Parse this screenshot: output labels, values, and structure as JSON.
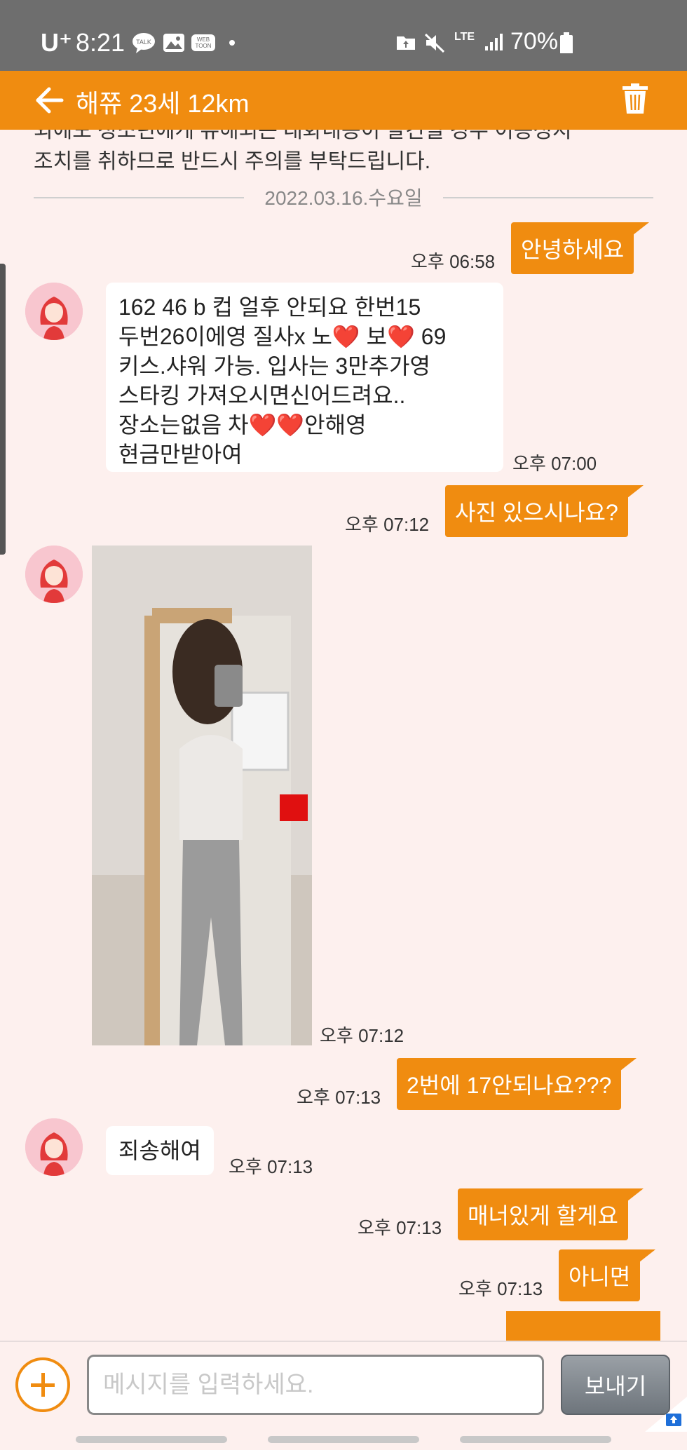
{
  "status_bar": {
    "carrier": "U⁺",
    "time": "8:21",
    "network": "LTE",
    "battery": "70%",
    "icons": [
      "kakaotalk-icon",
      "gallery-icon",
      "webtoon-icon",
      "dot-icon",
      "folder-icon",
      "mute-icon",
      "signal-icon",
      "battery-icon"
    ],
    "colors": {
      "bg": "#6e6e6e"
    }
  },
  "header": {
    "title": "해쮸 23세 12km",
    "back_icon": "arrow-left-icon",
    "delete_icon": "trash-icon",
    "colors": {
      "bg": "#f08c10"
    }
  },
  "chat": {
    "notice_partial": "외에도 청소년에게 유해되는 대화내용이 발견될 경우 이용정지",
    "notice_line2": "조치를 취하므로 반드시 주의를 부탁드립니다.",
    "date": "2022.03.16.수요일",
    "messages": [
      {
        "dir": "out",
        "text": "안녕하세요",
        "time": "오후 06:58"
      },
      {
        "dir": "in",
        "lines": [
          "162 46 b 컵 얼후 안되요 한번15",
          "두번26이에영 질사x 노❤️ 보❤️ 69",
          "키스.샤워 가능. 입사는 3만추가영",
          "스타킹 가져오시면신어드려요..",
          "장소는없음 차❤️❤️안해영",
          "현금만받아여"
        ],
        "time": "오후 07:00"
      },
      {
        "dir": "out",
        "text": "사진 있으시나요?",
        "time": "오후 07:12"
      },
      {
        "dir": "in",
        "type": "photo",
        "time": "오후 07:12"
      },
      {
        "dir": "out",
        "text": "2번에 17안되나요???",
        "time": "오후 07:13"
      },
      {
        "dir": "in",
        "text": "죄송해여",
        "time": "오후 07:13"
      },
      {
        "dir": "out",
        "text": "매너있게 할게요",
        "time": "오후 07:13"
      },
      {
        "dir": "out",
        "text": "아니면",
        "time": "오후 07:13"
      }
    ],
    "colors": {
      "bg": "#fdf0ee",
      "outgoing": "#f08c10",
      "incoming": "#ffffff"
    }
  },
  "input": {
    "placeholder": "메시지를 입력하세요.",
    "send_label": "보내기",
    "plus_icon": "plus-circle-icon"
  }
}
